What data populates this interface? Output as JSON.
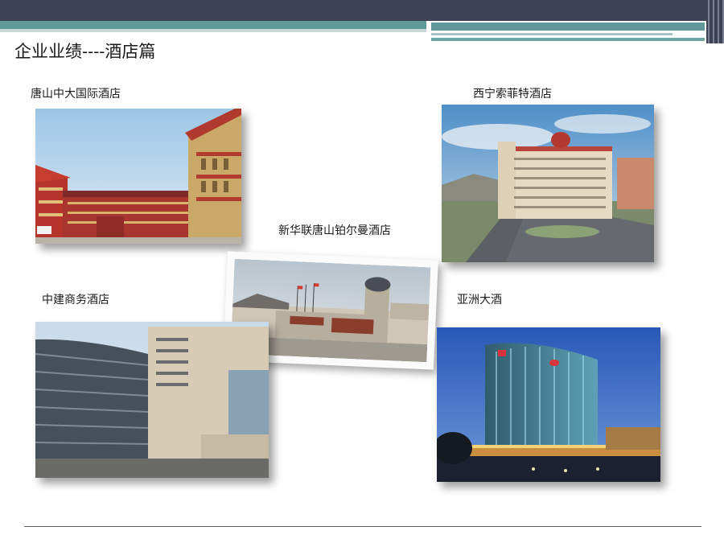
{
  "slide_title": "企业业绩----酒店篇",
  "hotels": [
    {
      "name": "唐山中大国际酒店"
    },
    {
      "name": "西宁索菲特酒店"
    },
    {
      "name": "新华联唐山铂尔曼酒店"
    },
    {
      "name": "中建商务酒店"
    },
    {
      "name": "亚洲大酒"
    }
  ],
  "colors": {
    "header_dark": "#3c4154",
    "header_teal": "#5f9a98"
  }
}
